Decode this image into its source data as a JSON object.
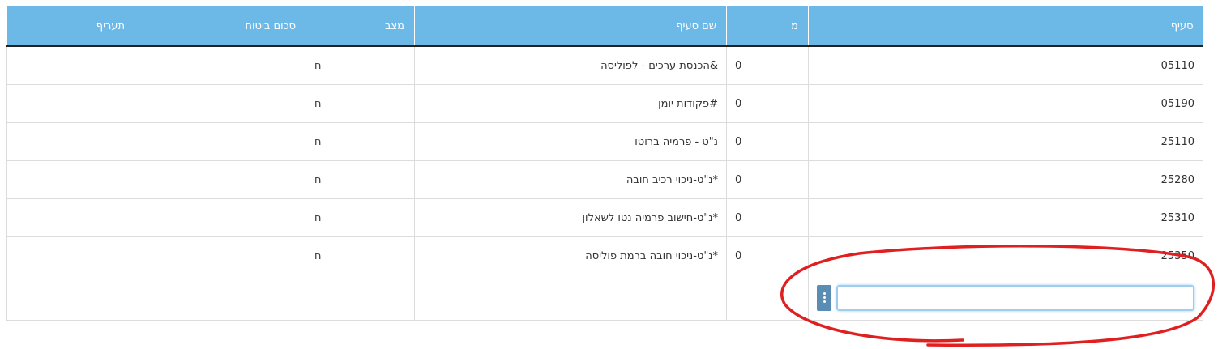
{
  "table": {
    "headers": {
      "seif": "סעיף",
      "mem": "מ",
      "shem_seif": "שם סעיף",
      "matzav": "מצב",
      "schum_bituach": "סכום ביטוח",
      "taarif": "תעריף"
    },
    "rows": [
      {
        "seif": "05110",
        "mem": "0",
        "shem_seif": "&הכנסת ערכים - לפוליסה",
        "matzav": "ח",
        "schum_bituach": "",
        "taarif": ""
      },
      {
        "seif": "05190",
        "mem": "0",
        "shem_seif": "#פקודות יומן",
        "matzav": "ח",
        "schum_bituach": "",
        "taarif": ""
      },
      {
        "seif": "25110",
        "mem": "0",
        "shem_seif": "נ\"ט - פרמיה ברוטו",
        "matzav": "ח",
        "schum_bituach": "",
        "taarif": ""
      },
      {
        "seif": "25280",
        "mem": "0",
        "shem_seif": "*נ\"ט-ניכוי רכיב חובה",
        "matzav": "ח",
        "schum_bituach": "",
        "taarif": ""
      },
      {
        "seif": "25310",
        "mem": "0",
        "shem_seif": "*נ\"ט-חישוב פרמיה נטו לשאלון",
        "matzav": "ח",
        "schum_bituach": "",
        "taarif": ""
      },
      {
        "seif": "25350",
        "mem": "0",
        "shem_seif": "*נ\"ט-ניכוי חובה ברמת פוליסה",
        "matzav": "ח",
        "schum_bituach": "",
        "taarif": ""
      }
    ],
    "new_row": {
      "seif_value": ""
    }
  },
  "colors": {
    "header_bg": "#6cb8e6",
    "annotation": "#e02020"
  }
}
